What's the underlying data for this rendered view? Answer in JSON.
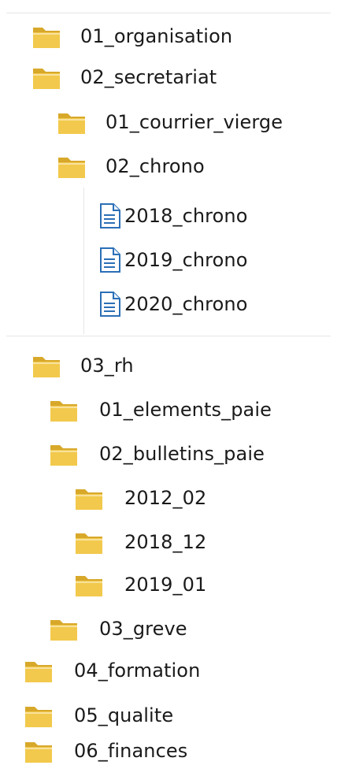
{
  "explorer": {
    "items": [
      {
        "label": "01_organisation",
        "type": "folder"
      },
      {
        "label": "02_secretariat",
        "type": "folder"
      },
      {
        "label": "01_courrier_vierge",
        "type": "folder"
      },
      {
        "label": "02_chrono",
        "type": "folder"
      },
      {
        "label": "2018_chrono",
        "type": "document"
      },
      {
        "label": "2019_chrono",
        "type": "document"
      },
      {
        "label": "2020_chrono",
        "type": "document"
      },
      {
        "label": "03_rh",
        "type": "folder"
      },
      {
        "label": "01_elements_paie",
        "type": "folder"
      },
      {
        "label": "02_bulletins_paie",
        "type": "folder"
      },
      {
        "label": "2012_02",
        "type": "folder"
      },
      {
        "label": "2018_12",
        "type": "folder"
      },
      {
        "label": "2019_01",
        "type": "folder"
      },
      {
        "label": "03_greve",
        "type": "folder"
      },
      {
        "label": "04_formation",
        "type": "folder"
      },
      {
        "label": "05_qualite",
        "type": "folder"
      },
      {
        "label": "06_finances",
        "type": "folder"
      }
    ]
  },
  "icons": {
    "folder": "folder-icon",
    "document": "document-icon"
  },
  "colors": {
    "folder_front": "#f2c94c",
    "folder_back": "#d8a82a",
    "doc_accent": "#2b6fb6"
  }
}
